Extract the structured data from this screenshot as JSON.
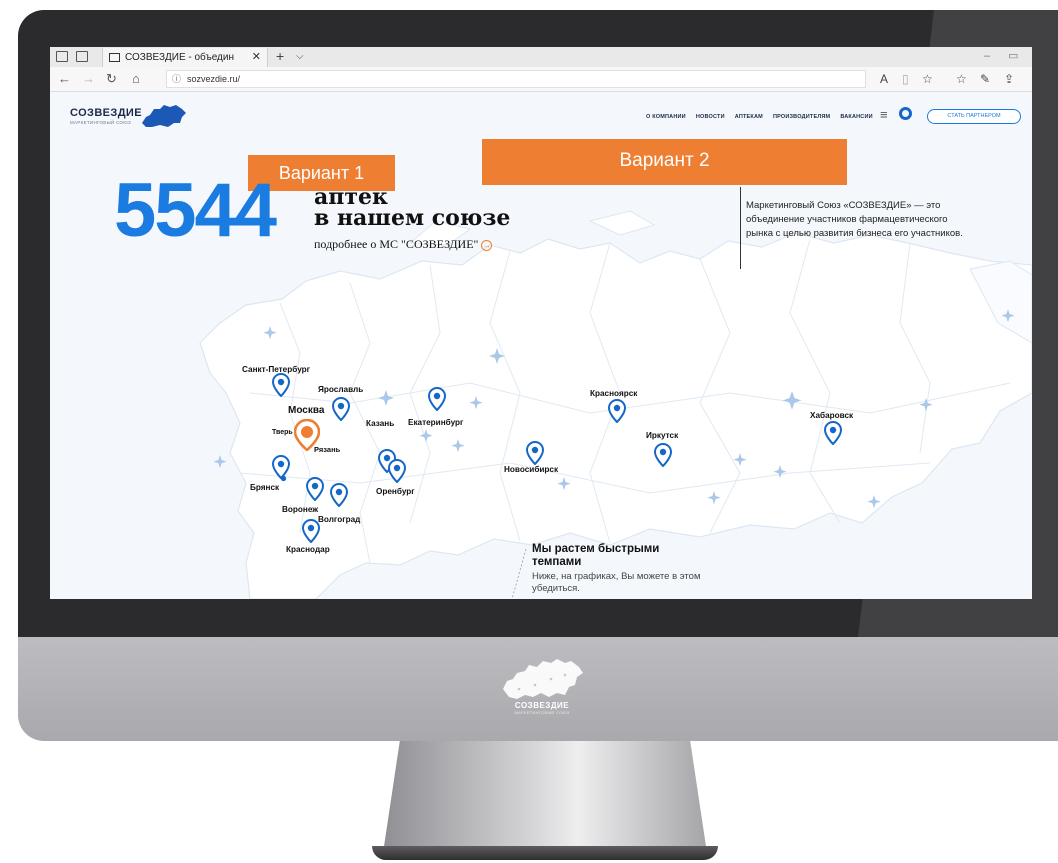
{
  "browser": {
    "tab_title": "СОЗВЕЗДИЕ - объедин",
    "url": "sozvezdie.ru/"
  },
  "site": {
    "logo_name": "СОЗВЕЗДИЕ",
    "logo_sub": "МАРКЕТИНГОВЫЙ СОЮЗ",
    "nav": [
      "О КОМПАНИИ",
      "НОВОСТИ",
      "АПТЕКАМ",
      "ПРОИЗВОДИТЕЛЯМ",
      "ВАКАНСИИ"
    ],
    "partner_button": "СТАТЬ ПАРТНЕРОМ"
  },
  "variants": {
    "v1": "Вариант 1",
    "v2": "Вариант 2"
  },
  "hero": {
    "number": "5544",
    "title_line1": "аптек",
    "title_line2": "в нашем союзе",
    "link": "подробнее о МС \"СОЗВЕЗДИЕ\""
  },
  "about": {
    "text": "Маркетинговый Союз «СОЗВЕЗДИЕ» — это объединение участников фармацевтического рынка с целью развития бизнеса его участников."
  },
  "growth": {
    "title": "Мы растем быстрыми темпами",
    "text": "Ниже, на графиках, Вы можете в этом убедиться."
  },
  "cities": {
    "spb": "Санкт-Петербург",
    "yaroslavl": "Ярославль",
    "moscow": "Москва",
    "tver": "Тверь",
    "ryazan": "Рязань",
    "kazan": "Казань",
    "ekaterinburg": "Екатеринбург",
    "bryansk": "Брянск",
    "voronezh": "Воронеж",
    "volgograd": "Волгоград",
    "krasnodar": "Краснодар",
    "orenburg": "Оренбург",
    "novosibirsk": "Новосибирск",
    "krasnoyarsk": "Красноярск",
    "irkutsk": "Иркутск",
    "khabarovsk": "Хабаровск"
  },
  "chin_logo": {
    "name": "СОЗВЕЗДИЕ",
    "sub": "МАРКЕТИНГОВЫЙ СОЮЗ"
  },
  "colors": {
    "accent_blue": "#1a7be0",
    "accent_orange": "#ee7e32",
    "pin_blue": "#1566c9"
  }
}
